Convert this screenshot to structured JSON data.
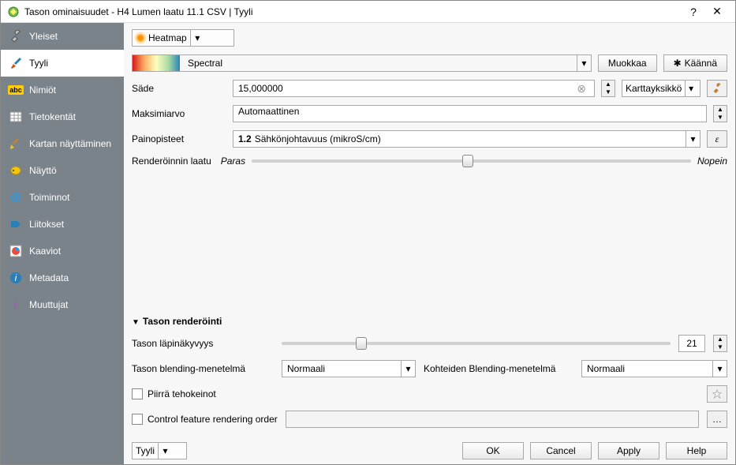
{
  "window": {
    "title": "Tason ominaisuudet - H4 Lumen laatu 11.1 CSV | Tyyli",
    "help_symbol": "?",
    "close_symbol": "✕"
  },
  "sidebar": {
    "items": [
      {
        "label": "Yleiset",
        "icon": "wrench-icon"
      },
      {
        "label": "Tyyli",
        "icon": "brush-icon"
      },
      {
        "label": "Nimiöt",
        "icon": "abc-icon"
      },
      {
        "label": "Tietokentät",
        "icon": "table-icon"
      },
      {
        "label": "Kartan näyttäminen",
        "icon": "broom-icon"
      },
      {
        "label": "Näyttö",
        "icon": "display-icon"
      },
      {
        "label": "Toiminnot",
        "icon": "gear-icon"
      },
      {
        "label": "Liitokset",
        "icon": "join-icon"
      },
      {
        "label": "Kaaviot",
        "icon": "chart-icon"
      },
      {
        "label": "Metadata",
        "icon": "info-icon"
      },
      {
        "label": "Muuttujat",
        "icon": "var-icon"
      }
    ],
    "active_index": 1
  },
  "style": {
    "renderer": "Heatmap",
    "color_ramp": "Spectral",
    "edit_btn": "Muokkaa",
    "invert_btn": "Käännä",
    "radius_label": "Säde",
    "radius_value": "15,000000",
    "radius_units": "Karttayksikkö",
    "max_label": "Maksimiarvo",
    "max_value": "Automaattinen",
    "weight_label": "Painopisteet",
    "weight_field_prefix": "1.2",
    "weight_field": "Sähkönjohtavuus (mikroS/cm)",
    "quality_label": "Renderöinnin laatu",
    "quality_left": "Paras",
    "quality_right": "Nopein"
  },
  "layer_rendering": {
    "section_title": "Tason renderöinti",
    "opacity_label": "Tason läpinäkyvyys",
    "opacity_value": "21",
    "layer_blend_label": "Tason blending-menetelmä",
    "layer_blend_value": "Normaali",
    "feature_blend_label": "Kohteiden Blending-menetelmä",
    "feature_blend_value": "Normaali",
    "draw_effects_label": "Piirrä tehokeinot",
    "control_order_label": "Control feature rendering order"
  },
  "bottom": {
    "style_menu": "Tyyli",
    "ok": "OK",
    "cancel": "Cancel",
    "apply": "Apply",
    "help": "Help"
  }
}
